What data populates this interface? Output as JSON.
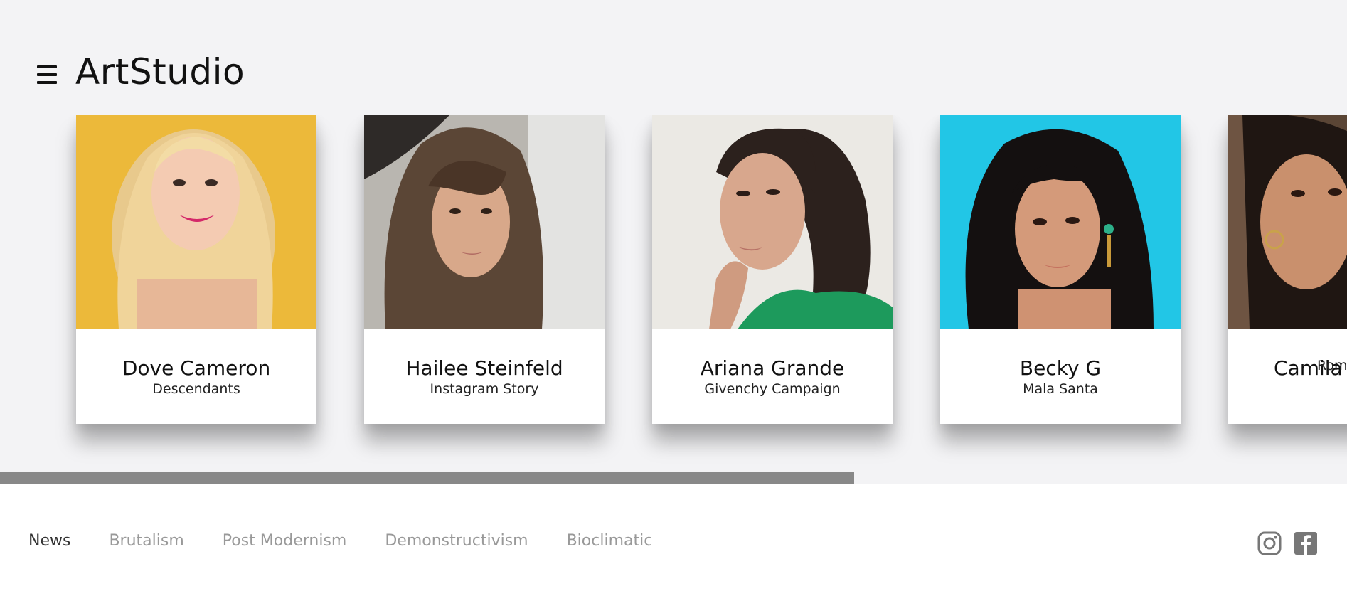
{
  "header": {
    "logo": "ArtStudio",
    "menu_icon": "hamburger-menu-icon"
  },
  "cards": [
    {
      "name": "Dove Cameron",
      "subtitle": "Descendants",
      "photo_bg": "#ecb93a"
    },
    {
      "name": "Hailee Steinfeld",
      "subtitle": "Instagram Story",
      "photo_bg": "#9a9590"
    },
    {
      "name": "Ariana Grande",
      "subtitle": "Givenchy Campaign",
      "photo_bg": "#ebe9e4"
    },
    {
      "name": "Becky G",
      "subtitle": "Mala Santa",
      "photo_bg": "#22c6e6"
    },
    {
      "name": "Camila",
      "subtitle": "Rom",
      "photo_bg": "#5a4535"
    }
  ],
  "scroll": {
    "position_fraction": 0.634
  },
  "footer": {
    "nav": [
      {
        "label": "News",
        "active": true
      },
      {
        "label": "Brutalism",
        "active": false
      },
      {
        "label": "Post Modernism",
        "active": false
      },
      {
        "label": "Demonstructivism",
        "active": false
      },
      {
        "label": "Bioclimatic",
        "active": false
      }
    ],
    "social": [
      "instagram-icon",
      "facebook-icon"
    ]
  },
  "colors": {
    "background_top": "#f3f3f5",
    "scrollbar": "#888888",
    "nav_inactive": "#999999",
    "nav_active": "#333333"
  }
}
